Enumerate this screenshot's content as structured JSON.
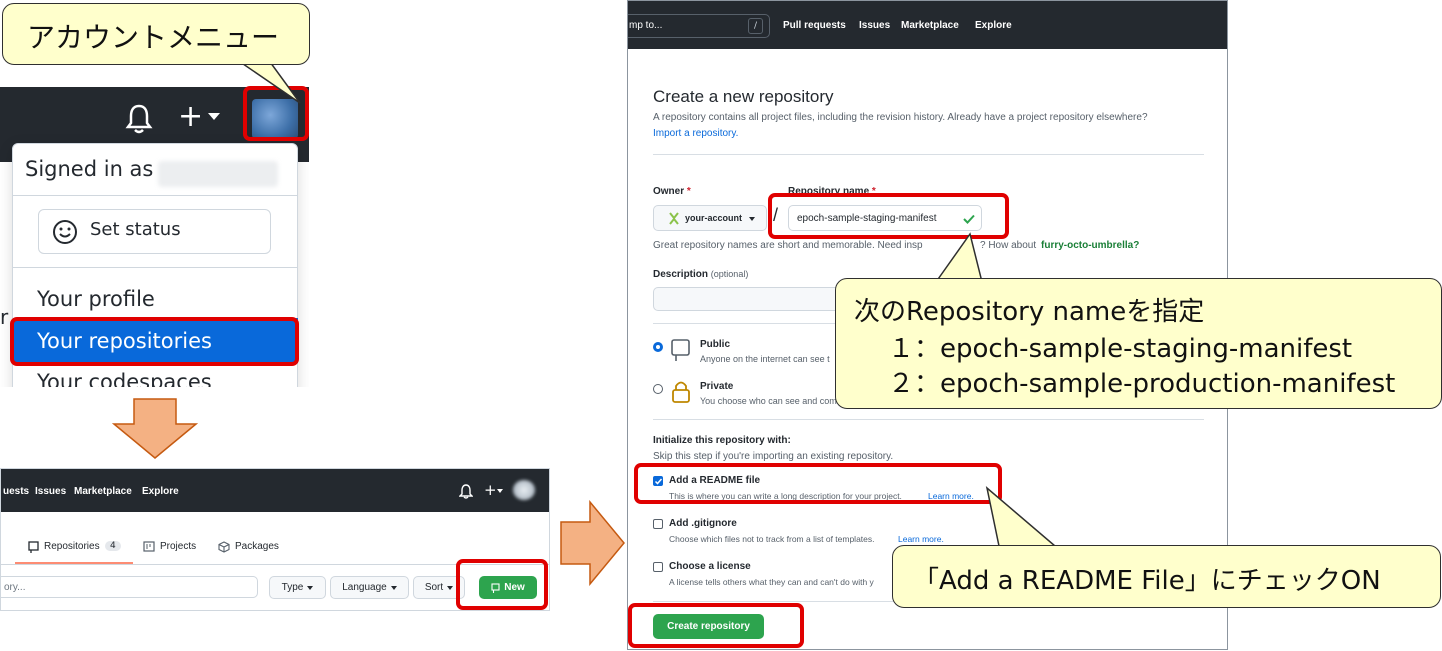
{
  "callouts": {
    "account_menu": "アカウントメニュー",
    "repo_name_line1": "次のRepository nameを指定",
    "repo_name_line2": "１：epoch-sample-staging-manifest",
    "repo_name_line3": "２：epoch-sample-production-manifest",
    "readme": "「Add a README File」にチェックON"
  },
  "account_menu": {
    "signed_in": "Signed in as",
    "set_status": "Set status",
    "your_profile": "Your profile",
    "your_repositories": "Your repositories",
    "your_codespaces": "Your codespaces",
    "cut_letter": "r"
  },
  "repos_page": {
    "nav": [
      "uests",
      "Issues",
      "Marketplace",
      "Explore"
    ],
    "tabs": {
      "repositories": "Repositories",
      "repositories_count": "4",
      "projects": "Projects",
      "packages": "Packages"
    },
    "filter_placeholder": "ory...",
    "type_label": "Type",
    "language_label": "Language",
    "sort_label": "Sort",
    "new_label": "New"
  },
  "create_page": {
    "search_text": "mp to...",
    "search_key": "/",
    "nav": [
      "Pull requests",
      "Issues",
      "Marketplace",
      "Explore"
    ],
    "title": "Create a new repository",
    "intro": "A repository contains all project files, including the revision history. Already have a project repository elsewhere?",
    "import_link": "Import a repository.",
    "owner_label": "Owner",
    "repo_name_label": "Repository name",
    "required_mark": "*",
    "owner_value": "your-account",
    "separator": "/",
    "repo_name_value": "epoch-sample-staging-manifest",
    "hint_prefix": "Great repository names are short and memorable. Need insp",
    "hint_suffix": "? How about",
    "hint_suggestion": "furry-octo-umbrella?",
    "description_label": "Description",
    "description_optional": "(optional)",
    "public_label": "Public",
    "public_desc": "Anyone on the internet can see t",
    "private_label": "Private",
    "private_desc": "You choose who can see and com",
    "init_title": "Initialize this repository with:",
    "init_skip": "Skip this step if you're importing an existing repository.",
    "readme_label": "Add a README file",
    "readme_desc": "This is where you can write a long description for your project.",
    "readme_link": "Learn more.",
    "gitignore_label": "Add .gitignore",
    "gitignore_desc": "Choose which files not to track from a list of templates.",
    "gitignore_link": "Learn more.",
    "license_label": "Choose a license",
    "license_desc": "A license tells others what they can and can't do with y",
    "create_button": "Create repository"
  },
  "colors": {
    "highlight": "#e00000",
    "callout_fill": "#ffffcc",
    "arrow_fill": "#f4b183",
    "header_dark": "#24292f",
    "primary_blue": "#0969da",
    "button_green": "#2da44e"
  }
}
